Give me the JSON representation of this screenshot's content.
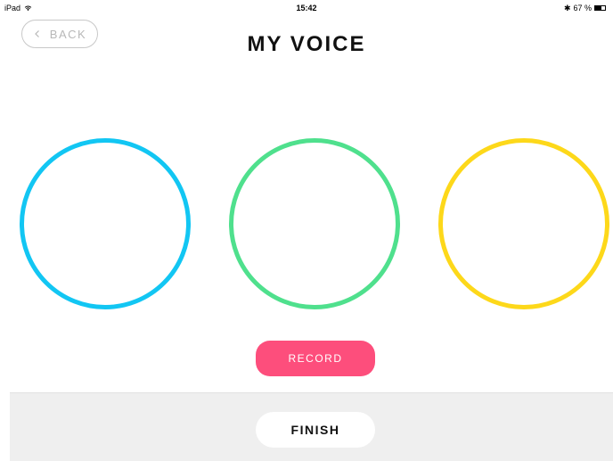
{
  "status_bar": {
    "device": "iPad",
    "time": "15:42",
    "battery_text": "67 %",
    "battery_level": 0.67,
    "wifi_icon": "wifi-icon",
    "bluetooth_icon": "bluetooth-icon",
    "battery_icon": "battery-icon"
  },
  "header": {
    "back_label": "BACK",
    "back_icon": "chevron-left-icon",
    "title": "MY VOICE"
  },
  "circles": [
    {
      "name": "blue",
      "color": "#12c6f3"
    },
    {
      "name": "green",
      "color": "#4fe08d"
    },
    {
      "name": "yellow",
      "color": "#fdd81a"
    }
  ],
  "actions": {
    "record_label": "RECORD",
    "record_color": "#fd4e7c",
    "finish_label": "FINISH"
  },
  "colors": {
    "background": "#ffffff",
    "bottom_bar": "#efefef",
    "title_text": "#111111",
    "back_text": "#b8b8b8"
  }
}
